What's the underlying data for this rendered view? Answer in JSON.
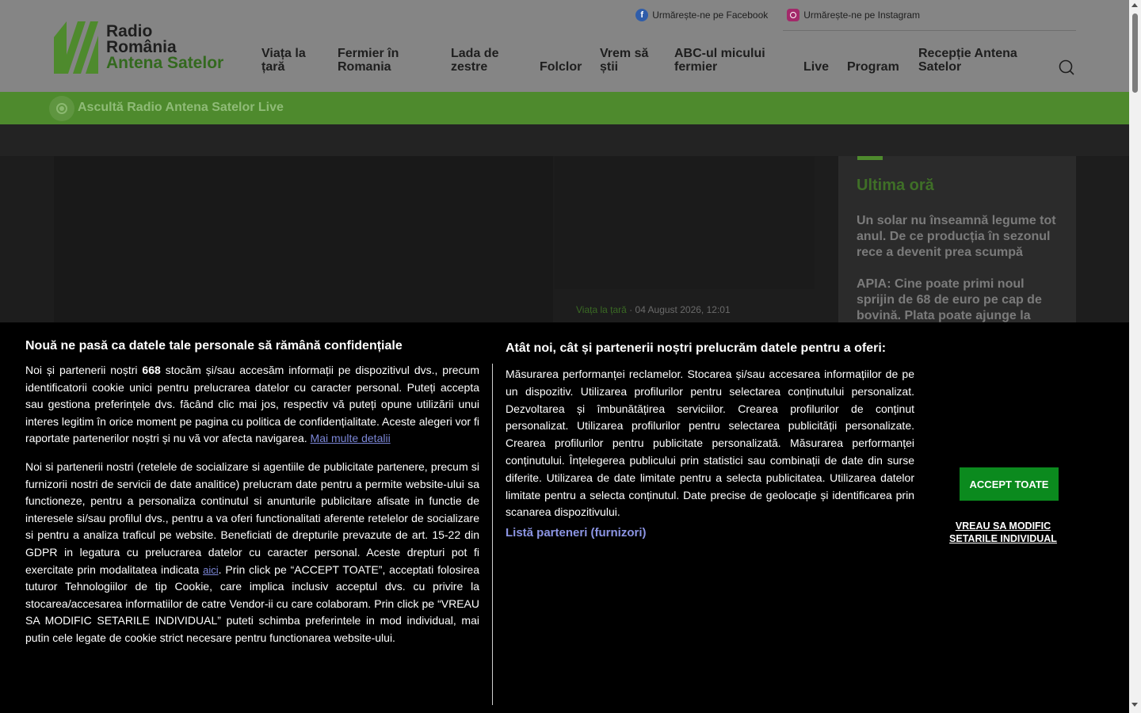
{
  "logo": {
    "line1": "Radio",
    "line2": "România",
    "line3": "Antena Satelor"
  },
  "social": {
    "facebook": "Urmărește-ne pe Facebook",
    "instagram": "Urmărește-ne pe Instagram"
  },
  "nav": [
    "Viața la țară",
    "Fermier în Romania",
    "Lada de zestre",
    "Folclor",
    "Vrem să știi",
    "ABC-ul micului fermier",
    "Live",
    "Program",
    "Recepție Antena Satelor"
  ],
  "livebar": {
    "label": "Ascultă Radio Antena Satelor Live"
  },
  "article": {
    "category": "Viața la țară",
    "date": "04 August 2026, 12:01"
  },
  "sidebar": {
    "title": "Ultima oră",
    "items": [
      "Un solar nu înseamnă legume tot anul. De ce producția în sezonul rece a devenit prea scumpă",
      "APIA: Cine poate primi noul sprijin de 68 de euro pe cap de bovină. Plata poate ajunge la"
    ]
  },
  "cookie": {
    "title": "Nouă ne pasă ca datele tale personale să rămână confidențiale",
    "p1_a": "Noi și partenerii noștri ",
    "p1_count": "668",
    "p1_b": " stocăm și/sau accesăm informații pe dispozitivul dvs., precum identificatorii cookie unici pentru prelucrarea datelor cu caracter personal. Puteți accepta sau gestiona preferințele dvs. făcând clic mai jos, respectiv vă puteți opune utilizării unui interes legitim în orice moment pe pagina cu politica de confidențialitate. Aceste alegeri vor fi raportate partenerilor noștri și nu vă vor afecta navigarea. ",
    "p1_link": "Mai multe detalii",
    "p2_a": "Noi si partenerii nostri (retelele de socializare si agentiile de publicitate partenere, precum si furnizorii nostri de servicii de date analitice) prelucram date pentru a permite website-ului sa functioneze, pentru a personaliza continutul si anunturile publicitare afisate in functie de interesele si/sau profilul dvs., pentru a va oferi functionalitati aferente retelelor de socializare si pentru a analiza traficul pe website. Beneficiati de drepturile prevazute de art. 15-22 din GDPR in legatura cu prelucrarea datelor cu caracter personal. Aceste drepturi pot fi exercitate prin modalitatea indicata ",
    "p2_link": "aici",
    "p2_b": ". Prin click pe “ACCEPT TOATE”, acceptati folosirea tuturor Tehnologiilor de tip Cookie, care implica inclusiv acceptul dvs. cu privire la stocarea/accesarea informatiilor de catre Vendor-ii cu care colaboram. Prin click pe “VREAU SA MODIFIC SETARILE INDIVIDUAL” puteti schimba preferintele in mod individual, mai putin cele legate de cookie strict necesare pentru functionarea website-ului.",
    "mid_title": "Atât noi, cât și partenerii noștri prelucrăm datele pentru a oferi:",
    "mid_text": "Măsurarea performanței reclamelor. Stocarea și/sau accesarea informațiilor de pe un dispozitiv. Utilizarea profilurilor pentru selectarea conținutului personalizat. Dezvoltarea și îmbunătățirea serviciilor. Crearea profilurilor de conținut personalizat. Utilizarea profilurilor pentru selectarea publicității personalizate. Crearea profilurilor pentru publicitate personalizată. Măsurarea performanței conținutului. Înțelegerea publicului prin statistici sau combinații de date din surse diferite. Utilizarea de date limitate pentru a selecta publicitatea. Utilizarea datelor limitate pentru a selecta conținutul. Date precise de geolocație și identificarea prin scanarea dispozitivului.",
    "partners": "Listă parteneri (furnizori)",
    "accept": "ACCEPT TOATE",
    "modify": "VREAU SA MODIFIC SETARILE INDIVIDUAL"
  },
  "colors": {
    "brand_green": "#4e8a2d",
    "accept_green": "#0b8a1e",
    "header_gray": "#858585"
  }
}
